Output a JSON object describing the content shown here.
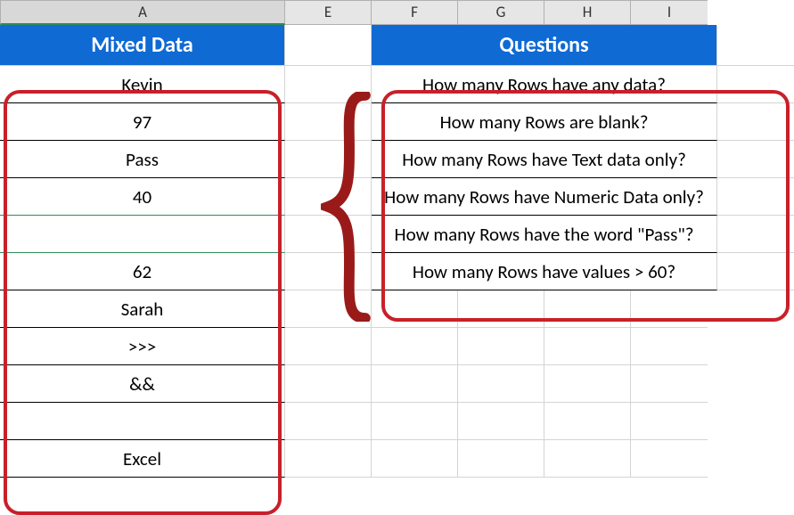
{
  "columns": {
    "A": "A",
    "E": "E",
    "F": "F",
    "G": "G",
    "H": "H",
    "I": "I"
  },
  "headers": {
    "mixed": "Mixed Data",
    "questions": "Questions"
  },
  "mixed": {
    "r1": "Kevin",
    "r2": "97",
    "r3": "Pass",
    "r4": "40",
    "r5": "",
    "r6": "62",
    "r7": "Sarah",
    "r8": ">>>",
    "r9": "&&",
    "r10": "",
    "r11": "Excel"
  },
  "questions": {
    "q1": "How many Rows have any data?",
    "q2": "How many Rows are blank?",
    "q3": "How many Rows have Text data only?",
    "q4": "How many Rows have Numeric Data only?",
    "q5": "How many Rows have the word \"Pass\"?",
    "q6": "How many Rows have values > 60?"
  },
  "chart_data": {
    "type": "table",
    "columns_visible": [
      "A",
      "E",
      "F",
      "G",
      "H",
      "I"
    ],
    "column_A_header": "Mixed Data",
    "column_A_values": [
      "Kevin",
      97,
      "Pass",
      40,
      "",
      62,
      "Sarah",
      ">>>",
      "&&",
      "",
      "Excel"
    ],
    "questions_header": "Questions",
    "questions_span": "F:I",
    "questions": [
      "How many Rows have any data?",
      "How many Rows are blank?",
      "How many Rows have Text data only?",
      "How many Rows have Numeric Data only?",
      "How many Rows have the word \"Pass\"?",
      "How many Rows have values > 60?"
    ]
  }
}
